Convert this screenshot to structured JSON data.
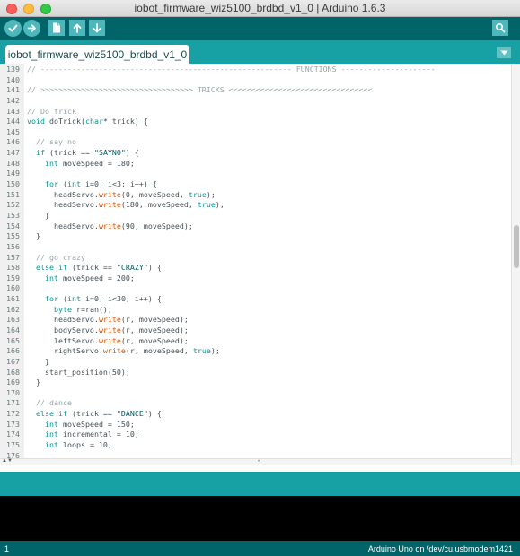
{
  "window": {
    "title": "iobot_firmware_wiz5100_brdbd_v1_0 | Arduino 1.6.3"
  },
  "toolbar": {
    "buttons": [
      {
        "name": "verify",
        "icon": "checkmark-icon"
      },
      {
        "name": "upload",
        "icon": "arrow-right-icon"
      },
      {
        "name": "new",
        "icon": "new-document-icon"
      },
      {
        "name": "open",
        "icon": "arrow-up-icon"
      },
      {
        "name": "save",
        "icon": "arrow-down-icon"
      }
    ],
    "serial_monitor_icon": "magnifier-icon"
  },
  "tabs": [
    {
      "label": "iobot_firmware_wiz5100_brdbd_v1_0",
      "active": true
    }
  ],
  "tab_menu_icon": "triangle-down-icon",
  "code": [
    {
      "n": "139",
      "t": [
        [
          "comment",
          "// -------------------------------------------------------- FUNCTIONS ---------------------"
        ]
      ]
    },
    {
      "n": "140",
      "t": []
    },
    {
      "n": "141",
      "t": [
        [
          "comment",
          "// >>>>>>>>>>>>>>>>>>>>>>>>>>>>>>>>>> TRICKS <<<<<<<<<<<<<<<<<<<<<<<<<<<<<<<<"
        ]
      ]
    },
    {
      "n": "142",
      "t": []
    },
    {
      "n": "143",
      "t": [
        [
          "comment",
          "// Do trick"
        ]
      ]
    },
    {
      "n": "144",
      "t": [
        [
          "type",
          "void"
        ],
        [
          "plain",
          " doTrick("
        ],
        [
          "type",
          "char"
        ],
        [
          "plain",
          "* trick) {"
        ]
      ]
    },
    {
      "n": "145",
      "t": []
    },
    {
      "n": "146",
      "t": [
        [
          "plain",
          "  "
        ],
        [
          "comment",
          "// say no"
        ]
      ]
    },
    {
      "n": "147",
      "t": [
        [
          "plain",
          "  "
        ],
        [
          "keyword",
          "if"
        ],
        [
          "plain",
          " (trick == "
        ],
        [
          "string",
          "\"SAYNO\""
        ],
        [
          "plain",
          ") {"
        ]
      ]
    },
    {
      "n": "148",
      "t": [
        [
          "plain",
          "    "
        ],
        [
          "type",
          "int"
        ],
        [
          "plain",
          " moveSpeed = 180;"
        ]
      ]
    },
    {
      "n": "149",
      "t": []
    },
    {
      "n": "150",
      "t": [
        [
          "plain",
          "    "
        ],
        [
          "keyword",
          "for"
        ],
        [
          "plain",
          " ("
        ],
        [
          "type",
          "int"
        ],
        [
          "plain",
          " i=0; i<3; i++) {"
        ]
      ]
    },
    {
      "n": "151",
      "t": [
        [
          "plain",
          "      headServo."
        ],
        [
          "method",
          "write"
        ],
        [
          "plain",
          "(0, moveSpeed, "
        ],
        [
          "keyword",
          "true"
        ],
        [
          "plain",
          ");"
        ]
      ]
    },
    {
      "n": "152",
      "t": [
        [
          "plain",
          "      headServo."
        ],
        [
          "method",
          "write"
        ],
        [
          "plain",
          "(180, moveSpeed, "
        ],
        [
          "keyword",
          "true"
        ],
        [
          "plain",
          ");"
        ]
      ]
    },
    {
      "n": "153",
      "t": [
        [
          "plain",
          "    }"
        ]
      ]
    },
    {
      "n": "154",
      "t": [
        [
          "plain",
          "      headServo."
        ],
        [
          "method",
          "write"
        ],
        [
          "plain",
          "(90, moveSpeed);"
        ]
      ]
    },
    {
      "n": "155",
      "t": [
        [
          "plain",
          "  }"
        ]
      ]
    },
    {
      "n": "156",
      "t": []
    },
    {
      "n": "157",
      "t": [
        [
          "plain",
          "  "
        ],
        [
          "comment",
          "// go crazy"
        ]
      ]
    },
    {
      "n": "158",
      "t": [
        [
          "plain",
          "  "
        ],
        [
          "keyword",
          "else if"
        ],
        [
          "plain",
          " (trick == "
        ],
        [
          "string",
          "\"CRAZY\""
        ],
        [
          "plain",
          ") {"
        ]
      ]
    },
    {
      "n": "159",
      "t": [
        [
          "plain",
          "    "
        ],
        [
          "type",
          "int"
        ],
        [
          "plain",
          " moveSpeed = 200;"
        ]
      ]
    },
    {
      "n": "160",
      "t": []
    },
    {
      "n": "161",
      "t": [
        [
          "plain",
          "    "
        ],
        [
          "keyword",
          "for"
        ],
        [
          "plain",
          " ("
        ],
        [
          "type",
          "int"
        ],
        [
          "plain",
          " i=0; i<30; i++) {"
        ]
      ]
    },
    {
      "n": "162",
      "t": [
        [
          "plain",
          "      "
        ],
        [
          "type",
          "byte"
        ],
        [
          "plain",
          " r=ran();"
        ]
      ]
    },
    {
      "n": "163",
      "t": [
        [
          "plain",
          "      headServo."
        ],
        [
          "method",
          "write"
        ],
        [
          "plain",
          "(r, moveSpeed);"
        ]
      ]
    },
    {
      "n": "164",
      "t": [
        [
          "plain",
          "      bodyServo."
        ],
        [
          "method",
          "write"
        ],
        [
          "plain",
          "(r, moveSpeed);"
        ]
      ]
    },
    {
      "n": "165",
      "t": [
        [
          "plain",
          "      leftServo."
        ],
        [
          "method",
          "write"
        ],
        [
          "plain",
          "(r, moveSpeed);"
        ]
      ]
    },
    {
      "n": "166",
      "t": [
        [
          "plain",
          "      rightServo."
        ],
        [
          "method",
          "write"
        ],
        [
          "plain",
          "(r, moveSpeed, "
        ],
        [
          "keyword",
          "true"
        ],
        [
          "plain",
          ");"
        ]
      ]
    },
    {
      "n": "167",
      "t": [
        [
          "plain",
          "    }"
        ]
      ]
    },
    {
      "n": "168",
      "t": [
        [
          "plain",
          "    start_position(50);"
        ]
      ]
    },
    {
      "n": "169",
      "t": [
        [
          "plain",
          "  }"
        ]
      ]
    },
    {
      "n": "170",
      "t": []
    },
    {
      "n": "171",
      "t": [
        [
          "plain",
          "  "
        ],
        [
          "comment",
          "// dance"
        ]
      ]
    },
    {
      "n": "172",
      "t": [
        [
          "plain",
          "  "
        ],
        [
          "keyword",
          "else if"
        ],
        [
          "plain",
          " (trick == "
        ],
        [
          "string",
          "\"DANCE\""
        ],
        [
          "plain",
          ") {"
        ]
      ]
    },
    {
      "n": "173",
      "t": [
        [
          "plain",
          "    "
        ],
        [
          "type",
          "int"
        ],
        [
          "plain",
          " moveSpeed = 150;"
        ]
      ]
    },
    {
      "n": "174",
      "t": [
        [
          "plain",
          "    "
        ],
        [
          "type",
          "int"
        ],
        [
          "plain",
          " incremental = 10;"
        ]
      ]
    },
    {
      "n": "175",
      "t": [
        [
          "plain",
          "    "
        ],
        [
          "type",
          "int"
        ],
        [
          "plain",
          " loops = 10;"
        ]
      ]
    },
    {
      "n": "176",
      "t": []
    }
  ],
  "editor": {
    "scroll_position": 0.45
  },
  "footer": {
    "line_number": "1",
    "board_port": "Arduino Uno on /dev/cu.usbmodem1421"
  },
  "colors": {
    "toolbar_bg": "#006468",
    "tabbar_bg": "#17a1a5",
    "button_bg": "#4db7bb",
    "comment": "#95a5a6",
    "keyword": "#00979c",
    "method": "#d35400",
    "string": "#005c5f"
  }
}
